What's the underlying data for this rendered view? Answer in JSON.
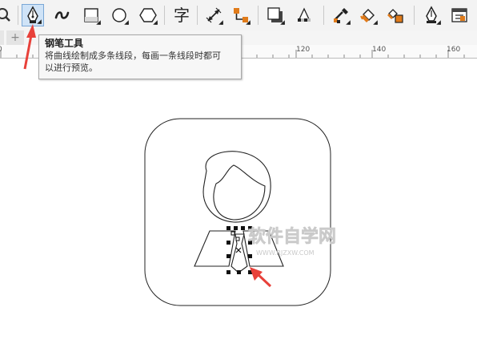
{
  "toolbar": {
    "tools": [
      {
        "name": "zoom-tool",
        "icon": "magnifier-icon"
      },
      {
        "name": "pen-tool",
        "icon": "pen-nib-icon",
        "active": true
      },
      {
        "name": "artistic-media-tool",
        "icon": "squiggle-icon"
      },
      {
        "name": "rectangle-tool",
        "icon": "rectangle-icon"
      },
      {
        "name": "ellipse-tool",
        "icon": "ellipse-icon"
      },
      {
        "name": "polygon-tool",
        "icon": "hexagon-icon"
      },
      {
        "name": "text-tool",
        "icon": "text-char-icon",
        "label": "字"
      },
      {
        "name": "dimension-tool",
        "icon": "dimension-line-icon"
      },
      {
        "name": "connector-tool",
        "icon": "connector-icon"
      },
      {
        "name": "drop-shadow-tool",
        "icon": "drop-shadow-icon"
      },
      {
        "name": "transparency-tool",
        "icon": "transparency-icon"
      },
      {
        "name": "eyedropper-tool",
        "icon": "eyedropper-icon"
      },
      {
        "name": "interactive-fill-tool",
        "icon": "fill-bucket-icon"
      },
      {
        "name": "smart-fill-tool",
        "icon": "smart-fill-icon"
      },
      {
        "name": "outline-pen-tool",
        "icon": "outline-pen-icon"
      },
      {
        "name": "object-properties-tool",
        "icon": "object-properties-icon"
      }
    ]
  },
  "tabs": {
    "add_label": "+"
  },
  "ruler": {
    "labels": [
      "0",
      "120",
      "140",
      "160"
    ]
  },
  "tooltip": {
    "title": "钢笔工具",
    "description_line1": "将曲线绘制成多条线段，每画一条线段时都可",
    "description_line2": "以进行预览。"
  },
  "watermark": {
    "text": "软件自学网",
    "url_text": "WWW.RJZXW.COM"
  },
  "colors": {
    "toolbar_bg": "#f3f3f3",
    "active_tool_bg": "#cfe3f7",
    "arrow_red": "#e8413a",
    "accent_orange": "#e07b1a"
  }
}
